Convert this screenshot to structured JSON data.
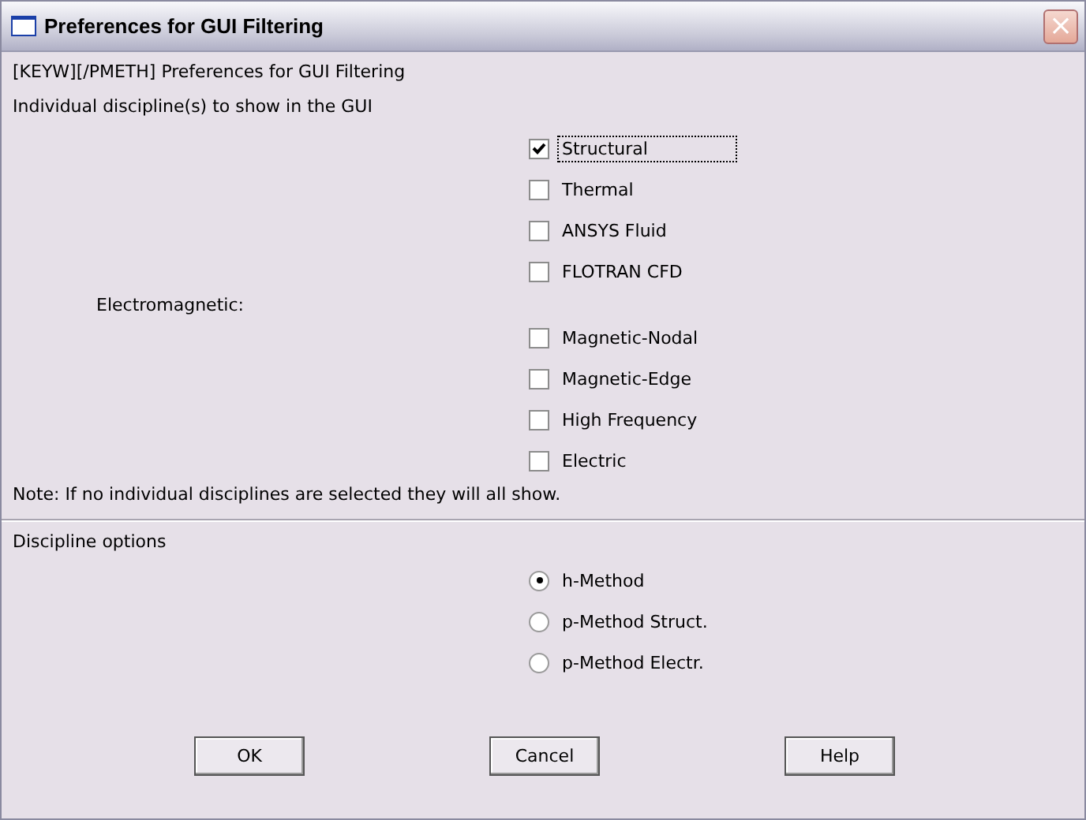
{
  "window": {
    "title": "Preferences for GUI Filtering",
    "close": "×"
  },
  "header": "[KEYW][/PMETH] Preferences for GUI Filtering",
  "disciplines_label": "Individual discipline(s) to show in the GUI",
  "disciplines": [
    {
      "kind": "checkbox",
      "label": "Structural",
      "checked": true,
      "focused": true
    },
    {
      "kind": "checkbox",
      "label": "Thermal",
      "checked": false,
      "focused": false
    },
    {
      "kind": "checkbox",
      "label": "ANSYS Fluid",
      "checked": false,
      "focused": false
    },
    {
      "kind": "checkbox",
      "label": "FLOTRAN CFD",
      "checked": false,
      "focused": false
    },
    {
      "kind": "heading",
      "label": "Electromagnetic:"
    },
    {
      "kind": "checkbox",
      "label": "Magnetic-Nodal",
      "checked": false,
      "focused": false
    },
    {
      "kind": "checkbox",
      "label": "Magnetic-Edge",
      "checked": false,
      "focused": false
    },
    {
      "kind": "checkbox",
      "label": "High Frequency",
      "checked": false,
      "focused": false
    },
    {
      "kind": "checkbox",
      "label": "Electric",
      "checked": false,
      "focused": false
    }
  ],
  "note": "Note: If no individual disciplines are selected they will all show.",
  "options_label": "Discipline options",
  "options": [
    {
      "label": "h-Method",
      "selected": true
    },
    {
      "label": "p-Method Struct.",
      "selected": false
    },
    {
      "label": "p-Method Electr.",
      "selected": false
    }
  ],
  "buttons": [
    "OK",
    "Cancel",
    "Help"
  ]
}
